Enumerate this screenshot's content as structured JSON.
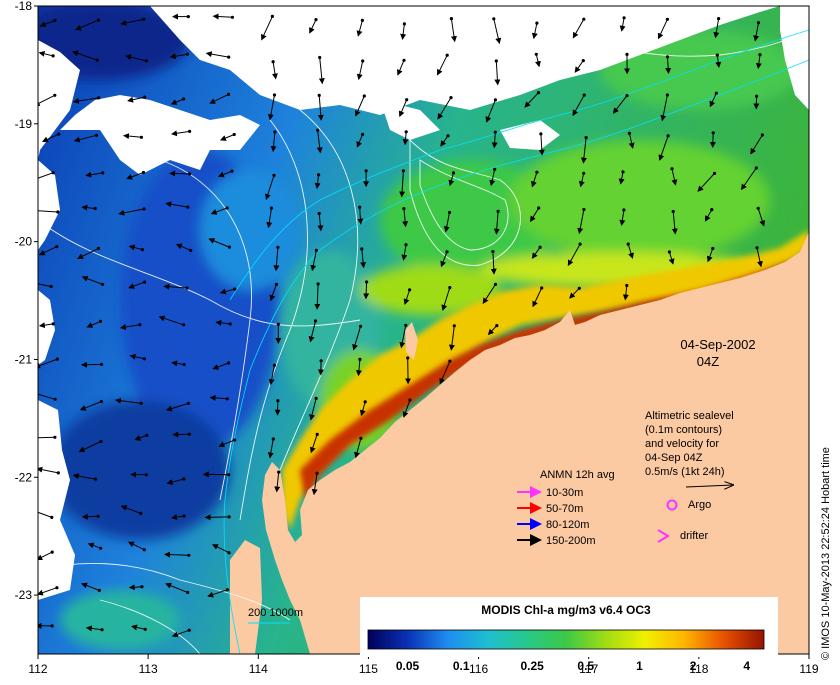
{
  "map": {
    "date": "04-Sep-2002",
    "time": "04Z",
    "x_ticks": [
      "112",
      "113",
      "114",
      "115",
      "116",
      "117",
      "118",
      "119"
    ],
    "y_ticks": [
      "-18",
      "-19",
      "-20",
      "-21",
      "-22",
      "-23"
    ],
    "extent": {
      "lon": [
        112,
        119
      ],
      "lat": [
        -23.5,
        -18
      ]
    },
    "colors": {
      "land": "#fbc9a2",
      "no_data": "#ffffff",
      "contour": "#ffffff",
      "vector": "#000000"
    }
  },
  "sealevel_note": {
    "lines": [
      "Altimetric sealevel",
      "(0.1m contours)",
      "and velocity for",
      "04-Sep 04Z"
    ],
    "scale_label": "0.5m/s (1kt 24h)"
  },
  "anmn_legend": {
    "title": "ANMN 12h avg",
    "items": [
      {
        "label": "10-30m",
        "color": "#ff33ff"
      },
      {
        "label": "50-70m",
        "color": "#ff0000"
      },
      {
        "label": "80-120m",
        "color": "#0000ff"
      },
      {
        "label": "150-200m",
        "color": "#000000"
      }
    ]
  },
  "markers": {
    "argo": {
      "label": "Argo",
      "color": "#ff33ff"
    },
    "drifter": {
      "label": "drifter",
      "color": "#ff33ff"
    }
  },
  "isobath_label": "200  1000m",
  "colorbar": {
    "title": "MODIS Chl-a mg/m3 v6.4 OC3",
    "ticks": [
      "0.05",
      "0.1",
      "0.25",
      "0.5",
      "1",
      "2",
      "4"
    ],
    "tick_values": [
      0.05,
      0.1,
      0.25,
      0.5,
      1,
      2,
      4
    ],
    "range": [
      0.03,
      5
    ],
    "gradient": [
      "#00005a",
      "#0a32b4",
      "#1e8cf0",
      "#1ebed2",
      "#28c88c",
      "#3cc846",
      "#a0dc14",
      "#f0f000",
      "#ffb400",
      "#e65000",
      "#961400"
    ]
  },
  "credit": "© IMOS 10-May-2013 22:52:24 Hobart time"
}
